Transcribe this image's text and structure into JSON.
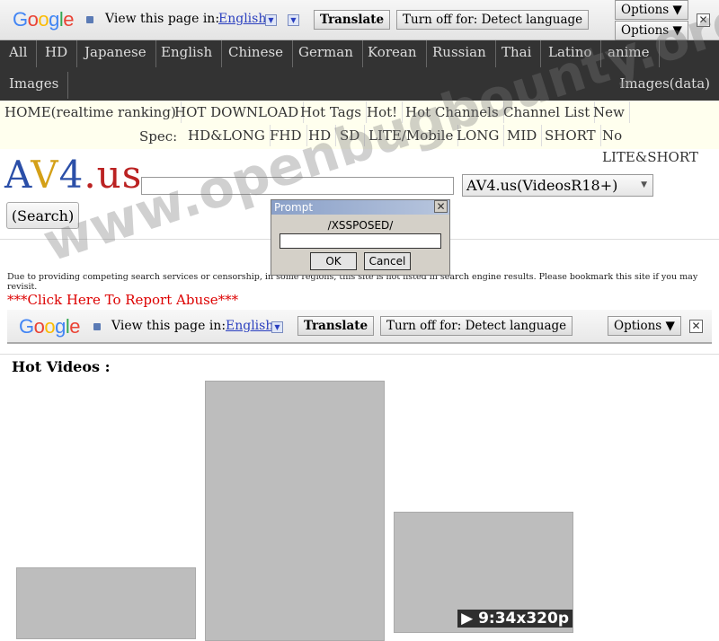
{
  "translate_bar": {
    "logo": "Google",
    "view_label": "View this page in:",
    "language": "English",
    "translate": "Translate",
    "turn_off": "Turn off for: Detect language",
    "options": "Options ▼",
    "close": "✕"
  },
  "nav": {
    "row1": [
      "All",
      "HD",
      "Japanese",
      "English",
      "Chinese",
      "German",
      "Korean",
      "Russian",
      "Thai",
      "Latino",
      "anime"
    ],
    "images": "Images",
    "images_data": "Images(data)"
  },
  "menu": {
    "items": [
      "HOME(realtime ranking)",
      "HOT DOWNLOAD",
      "Hot Tags",
      "Hot!",
      "Hot Channels",
      "Channel List",
      "New"
    ],
    "spec_label": "Spec:",
    "spec": [
      "HD&LONG",
      "FHD",
      "HD",
      "SD",
      "LITE/Mobile",
      "LONG",
      "MID",
      "SHORT",
      "No LITE&SHORT"
    ]
  },
  "search": {
    "logo": "AV4.us",
    "query": "",
    "site_select": "AV4.us(VideosR18+)",
    "button": "(Search)"
  },
  "prompt": {
    "title": "Prompt",
    "message": "/XSSPOSED/",
    "value": "",
    "ok": "OK",
    "cancel": "Cancel"
  },
  "notice": "Due to providing competing search services or censorship, in some regions, this site is not listed in search engine results. Please bookmark this site if you may revisit.",
  "report_abuse": "***Click Here To Report Abuse***",
  "hot_videos": {
    "heading": "Hot Videos :",
    "videos": [
      {
        "caption": ""
      },
      {
        "caption": ""
      },
      {
        "caption": "▶ 9:34x320p"
      }
    ]
  },
  "watermark": "www.openbugbounty.org",
  "colors": {
    "nav_bg": "#333333",
    "menu_bg": "#ffffee",
    "link": "#2a3fbf",
    "abuse": "#dd0000"
  }
}
